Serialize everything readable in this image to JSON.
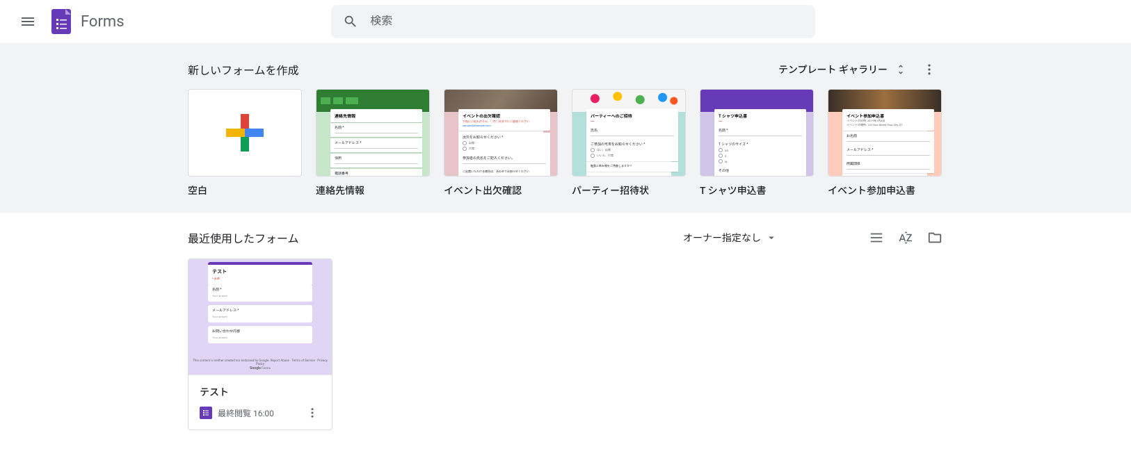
{
  "app": {
    "name": "Forms"
  },
  "search": {
    "placeholder": "検索"
  },
  "templates": {
    "heading": "新しいフォームを作成",
    "gallery_label": "テンプレート ギャラリー",
    "items": [
      {
        "label": "空白"
      },
      {
        "label": "連絡先情報",
        "card_title": "連絡先情報"
      },
      {
        "label": "イベント出欠確認",
        "card_title": "イベントの出欠確認"
      },
      {
        "label": "パーティー招待状",
        "card_title": "パーティーへのご招待"
      },
      {
        "label": "T シャツ申込書",
        "card_title": "T シャツ申込書"
      },
      {
        "label": "イベント参加申込書",
        "card_title": "イベント参加申込書"
      }
    ]
  },
  "recent": {
    "heading": "最近使用したフォーム",
    "owner_filter": "オーナー指定なし",
    "items": [
      {
        "name": "テスト",
        "meta": "最終閲覧 16:00",
        "preview_title": "テスト"
      }
    ]
  }
}
